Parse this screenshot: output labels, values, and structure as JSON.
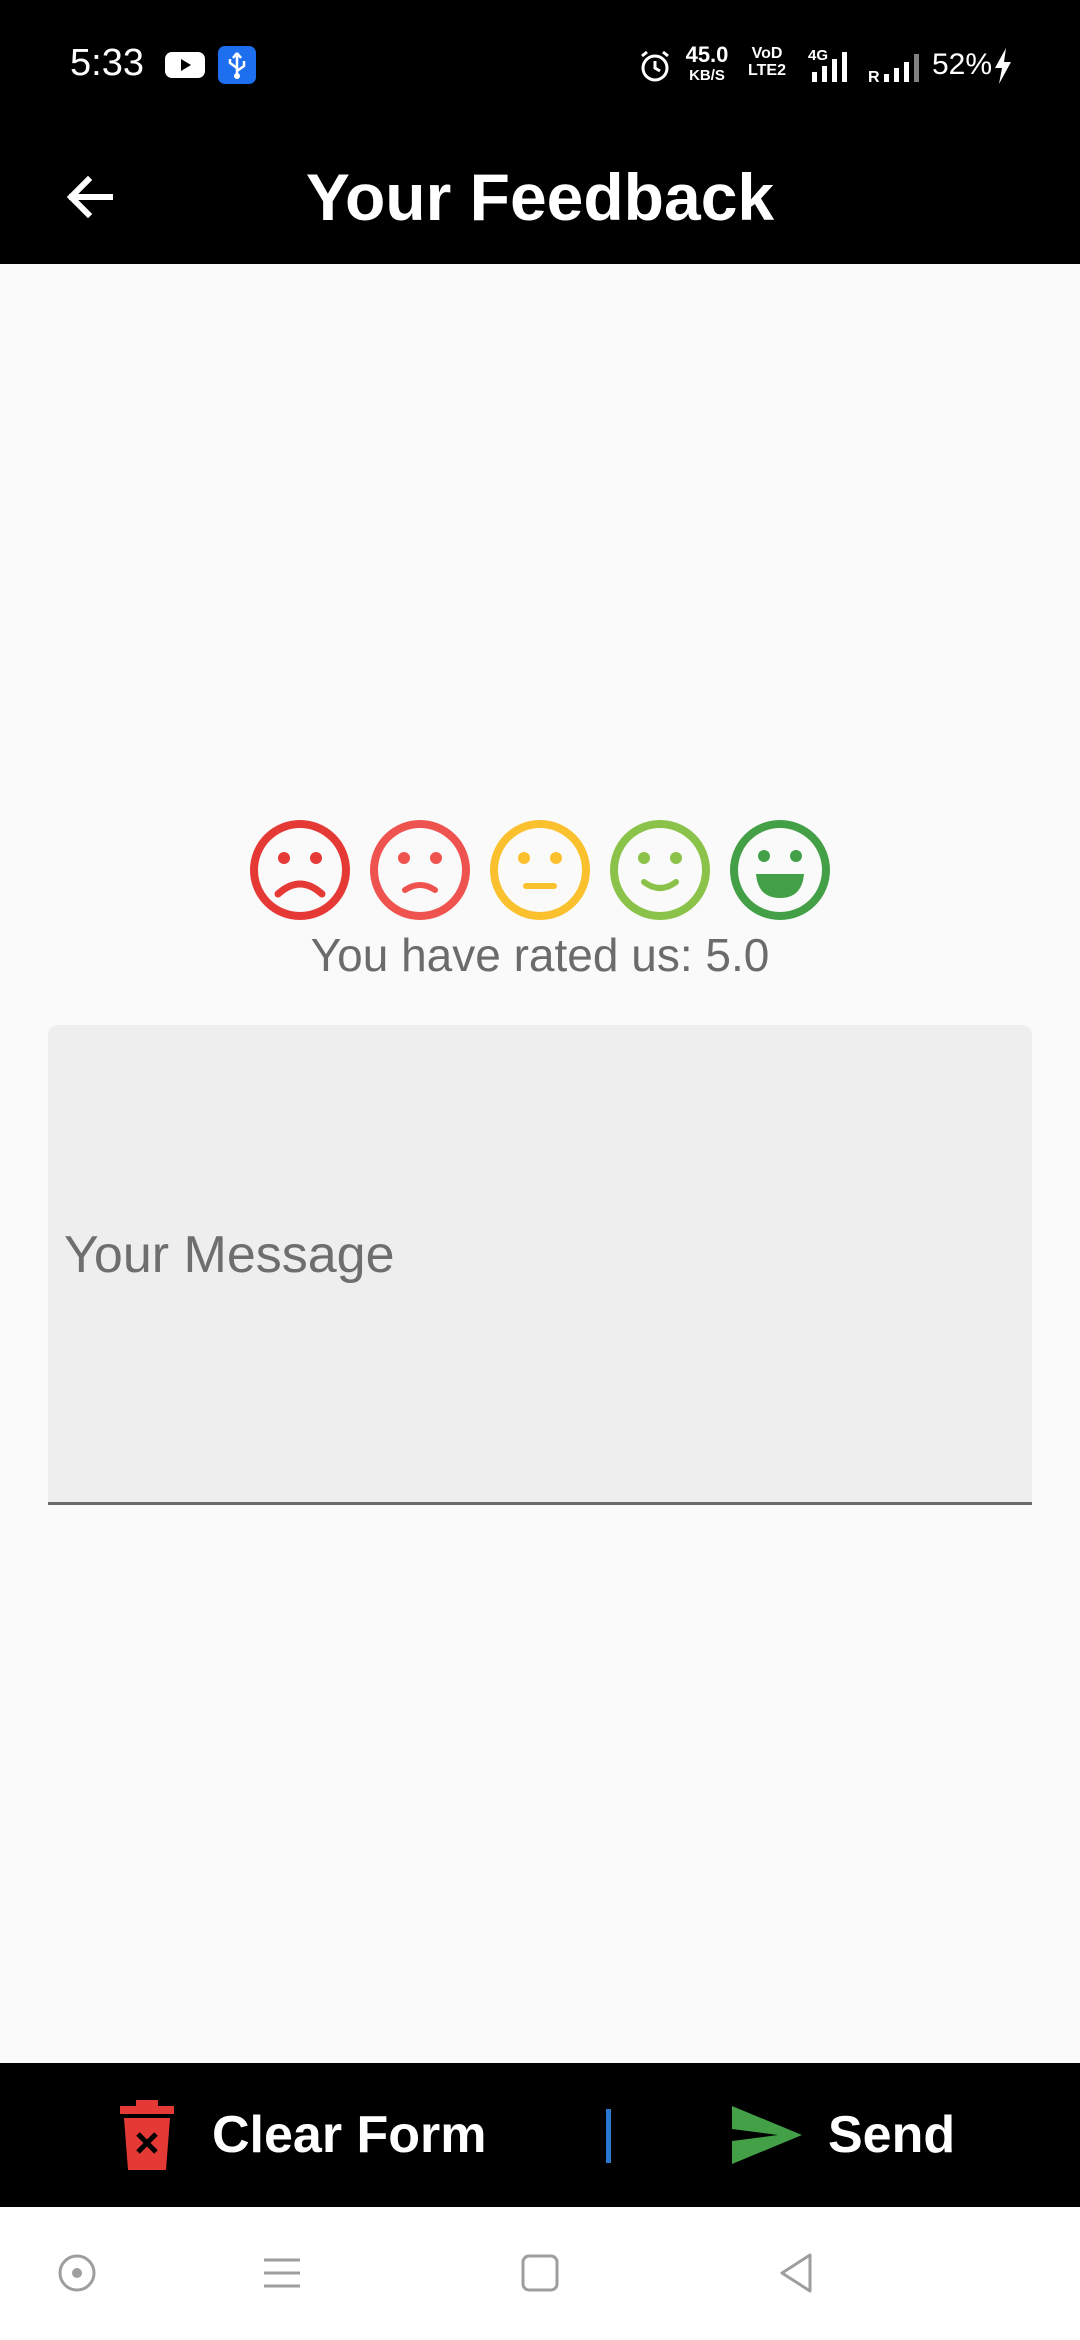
{
  "status_bar": {
    "time": "5:33",
    "speed_value": "45.0",
    "speed_unit": "KB/S",
    "volte_line1": "VoD",
    "volte_line2": "LTE2",
    "network_type": "4G",
    "roaming": "R",
    "battery": "52%",
    "icons": [
      "youtube-icon",
      "usb-icon",
      "alarm-icon",
      "signal-icon",
      "signal-icon",
      "charging-icon"
    ]
  },
  "app_bar": {
    "title": "Your Feedback",
    "back_icon": "arrow-left-icon"
  },
  "rating": {
    "faces": [
      "very-dissatisfied",
      "dissatisfied",
      "neutral",
      "satisfied",
      "very-satisfied"
    ],
    "colors": [
      "#e53935",
      "#ef5350",
      "#fbc02d",
      "#8bc34a",
      "#43a047"
    ],
    "text": "You have rated us: 5.0",
    "value": 5.0
  },
  "message": {
    "placeholder": "Your Message",
    "value": ""
  },
  "actions": {
    "clear_label": "Clear Form",
    "clear_icon": "trash-icon",
    "clear_color": "#e53935",
    "send_label": "Send",
    "send_icon": "send-icon",
    "send_color": "#43a047",
    "divider_color": "#2979d2"
  },
  "nav_bar": {
    "buttons": [
      "assistant-icon",
      "menu-icon",
      "home-icon",
      "back-icon"
    ]
  }
}
